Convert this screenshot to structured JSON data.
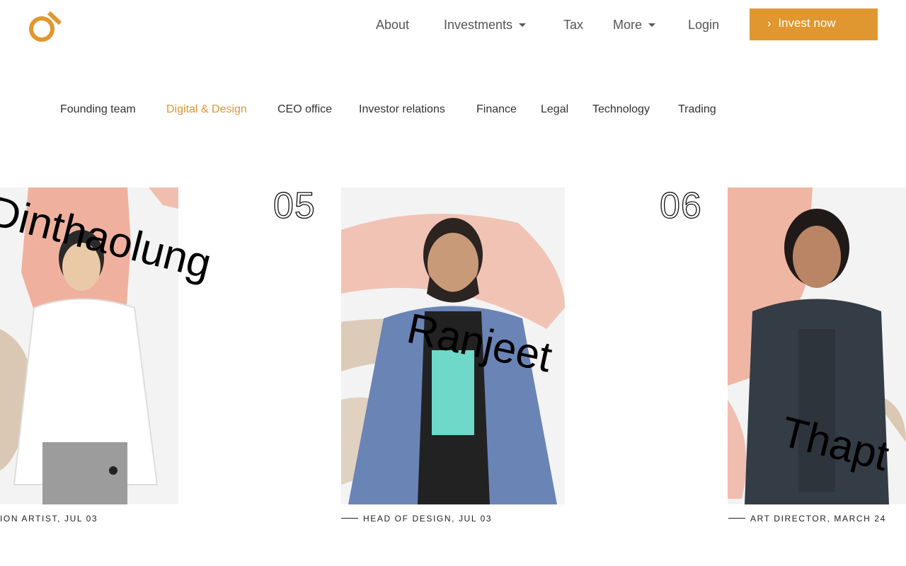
{
  "header": {
    "nav": [
      {
        "label": "About"
      },
      {
        "label": "Investments"
      },
      {
        "label": "Tax"
      },
      {
        "label": "More"
      },
      {
        "label": "Login"
      }
    ],
    "cta_label": "Invest now",
    "brand_color": "#e0972f",
    "logo_icon": "logo-icon"
  },
  "tabs": {
    "items": [
      {
        "label": "Founding team"
      },
      {
        "label": "Digital & Design"
      },
      {
        "label": "CEO office"
      },
      {
        "label": "Investor relations"
      },
      {
        "label": "Finance"
      },
      {
        "label": "Legal"
      },
      {
        "label": "Technology"
      },
      {
        "label": "Trading"
      }
    ],
    "active": "Digital & Design"
  },
  "team": [
    {
      "number": "",
      "name": "Dinthaolung",
      "caption": "ION ARTIST, JUL 03"
    },
    {
      "number": "05",
      "name": "Ranjeet",
      "caption": "HEAD OF DESIGN, JUL 03"
    },
    {
      "number": "06",
      "name": "Thapt",
      "caption": "ART DIRECTOR, MARCH 24"
    }
  ]
}
